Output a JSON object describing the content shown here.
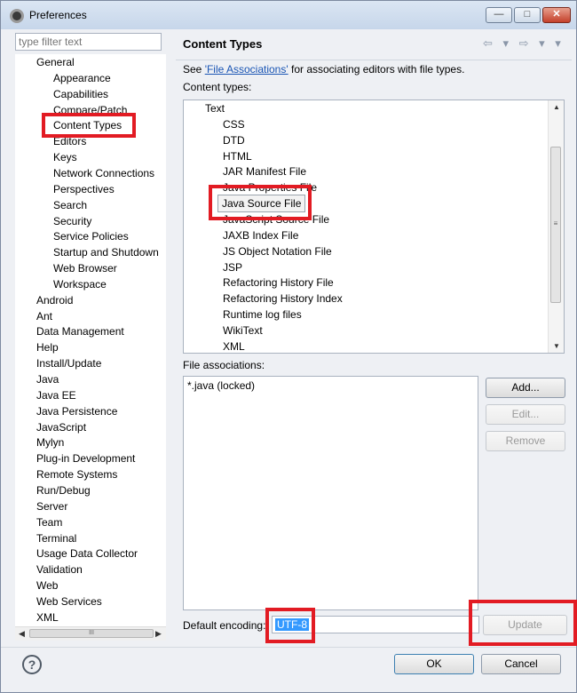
{
  "window": {
    "title": "Preferences",
    "min": "—",
    "max": "□",
    "close": "✕"
  },
  "filter": {
    "placeholder": "type filter text"
  },
  "tree": [
    {
      "label": "General",
      "level": 1
    },
    {
      "label": "Appearance",
      "level": 2
    },
    {
      "label": "Capabilities",
      "level": 2
    },
    {
      "label": "Compare/Patch",
      "level": 2
    },
    {
      "label": "Content Types",
      "level": 2,
      "selected": true
    },
    {
      "label": "Editors",
      "level": 2
    },
    {
      "label": "Keys",
      "level": 2
    },
    {
      "label": "Network Connections",
      "level": 2
    },
    {
      "label": "Perspectives",
      "level": 2
    },
    {
      "label": "Search",
      "level": 2
    },
    {
      "label": "Security",
      "level": 2
    },
    {
      "label": "Service Policies",
      "level": 2
    },
    {
      "label": "Startup and Shutdown",
      "level": 2
    },
    {
      "label": "Web Browser",
      "level": 2
    },
    {
      "label": "Workspace",
      "level": 2
    },
    {
      "label": "Android",
      "level": 1
    },
    {
      "label": "Ant",
      "level": 1
    },
    {
      "label": "Data Management",
      "level": 1
    },
    {
      "label": "Help",
      "level": 1
    },
    {
      "label": "Install/Update",
      "level": 1
    },
    {
      "label": "Java",
      "level": 1
    },
    {
      "label": "Java EE",
      "level": 1
    },
    {
      "label": "Java Persistence",
      "level": 1
    },
    {
      "label": "JavaScript",
      "level": 1
    },
    {
      "label": "Mylyn",
      "level": 1
    },
    {
      "label": "Plug-in Development",
      "level": 1
    },
    {
      "label": "Remote Systems",
      "level": 1
    },
    {
      "label": "Run/Debug",
      "level": 1
    },
    {
      "label": "Server",
      "level": 1
    },
    {
      "label": "Team",
      "level": 1
    },
    {
      "label": "Terminal",
      "level": 1
    },
    {
      "label": "Usage Data Collector",
      "level": 1
    },
    {
      "label": "Validation",
      "level": 1
    },
    {
      "label": "Web",
      "level": 1
    },
    {
      "label": "Web Services",
      "level": 1
    },
    {
      "label": "XML",
      "level": 1
    }
  ],
  "page": {
    "title": "Content Types",
    "nav_arrows": "⇦ ▾ ⇨ ▾ ▾",
    "see_prefix": "See ",
    "see_link": "'File Associations'",
    "see_suffix": " for associating editors with file types.",
    "content_types_label": "Content types:",
    "file_assoc_label": "File associations:",
    "default_encoding_label": "Default encoding:",
    "default_encoding_value": "UTF-8"
  },
  "content_types": [
    {
      "label": "Text",
      "level": 1
    },
    {
      "label": "CSS",
      "level": 2
    },
    {
      "label": "DTD",
      "level": 2
    },
    {
      "label": "HTML",
      "level": 2
    },
    {
      "label": "JAR Manifest File",
      "level": 2
    },
    {
      "label": "Java Properties File",
      "level": 2
    },
    {
      "label": "Java Source File",
      "level": 2,
      "selected": true
    },
    {
      "label": "JavaScript Source File",
      "level": 2
    },
    {
      "label": "JAXB Index File",
      "level": 2
    },
    {
      "label": "JS Object Notation File",
      "level": 2
    },
    {
      "label": "JSP",
      "level": 2
    },
    {
      "label": "Refactoring History File",
      "level": 2
    },
    {
      "label": "Refactoring History Index",
      "level": 2
    },
    {
      "label": "Runtime log files",
      "level": 2
    },
    {
      "label": "WikiText",
      "level": 2
    },
    {
      "label": "XML",
      "level": 2
    }
  ],
  "file_associations": [
    "*.java (locked)"
  ],
  "buttons": {
    "add": "Add...",
    "edit": "Edit...",
    "remove": "Remove",
    "update": "Update",
    "ok": "OK",
    "cancel": "Cancel",
    "help": "?"
  },
  "scroll": {
    "up": "▲",
    "down": "▼",
    "left": "◀",
    "right": "▶",
    "grip_v": "≡",
    "grip_h": "III"
  },
  "colors": {
    "highlight": "#e21b23",
    "selection": "#3399ff",
    "link": "#1a55b4"
  }
}
